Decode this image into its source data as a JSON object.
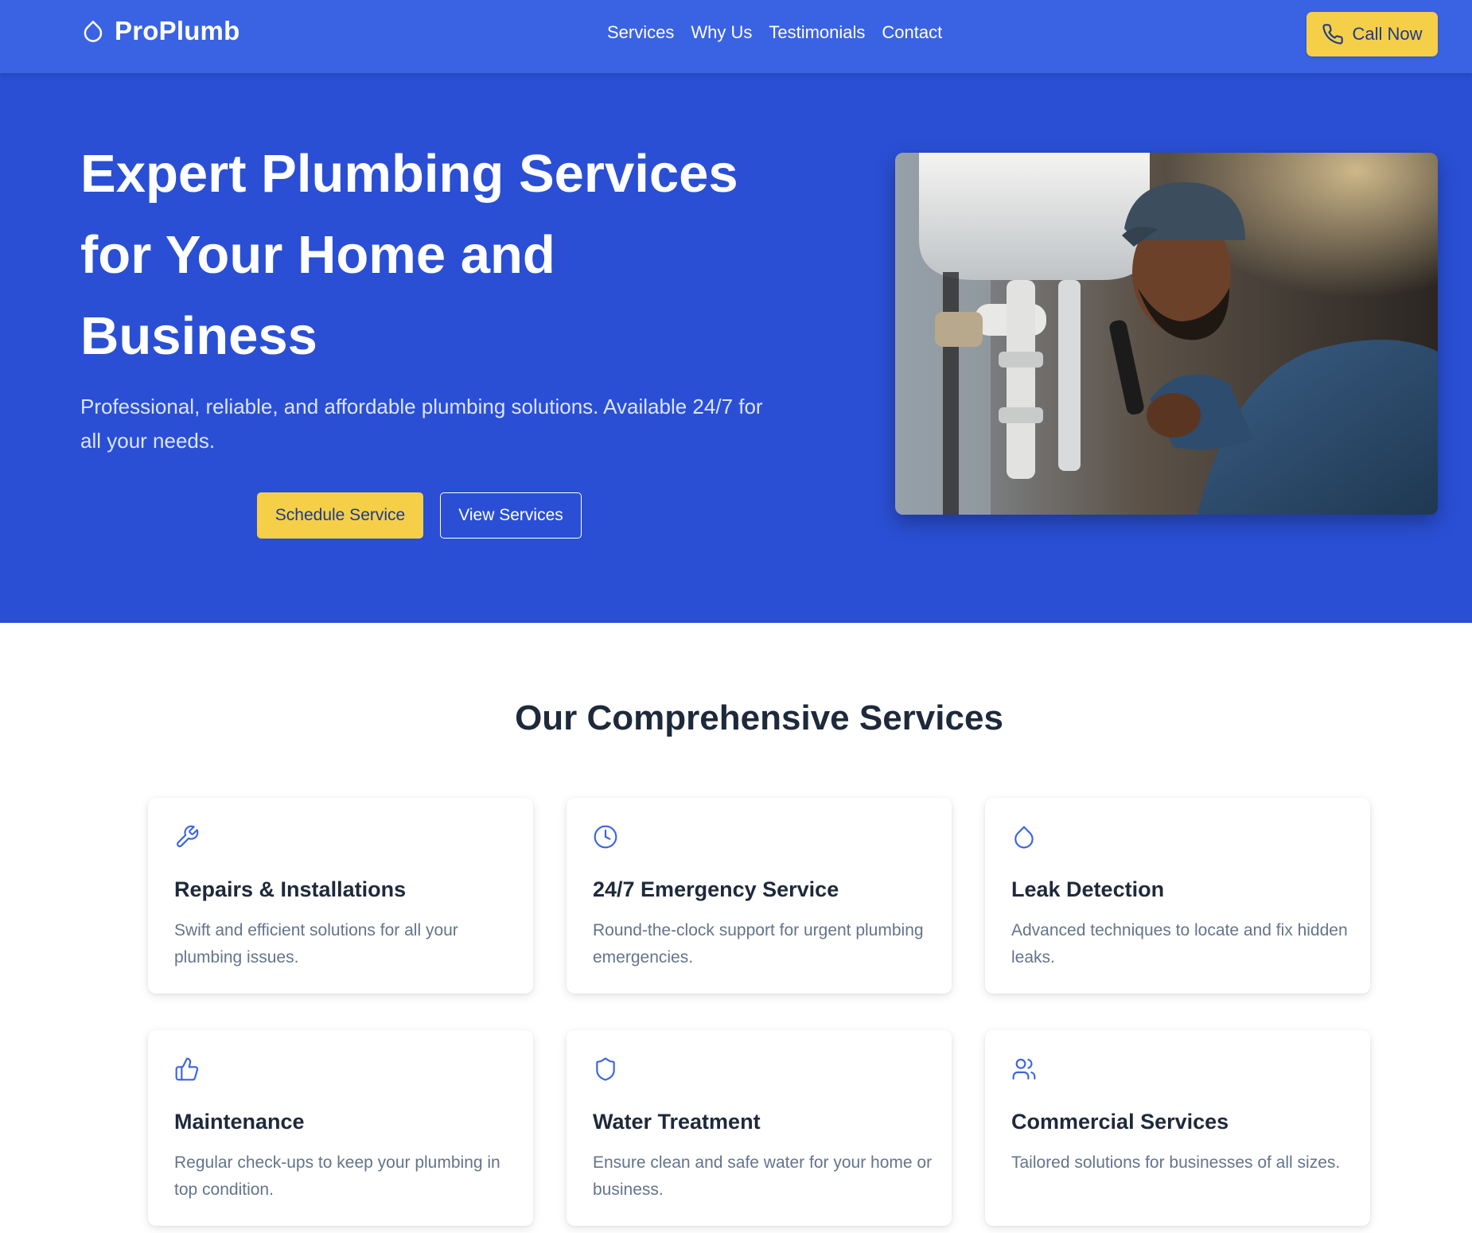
{
  "nav": {
    "brand": "ProPlumb",
    "links": [
      "Services",
      "Why Us",
      "Testimonials",
      "Contact"
    ],
    "cta": "Call Now"
  },
  "hero": {
    "title": "Expert Plumbing Services for Your Home and Business",
    "subtitle": "Professional, reliable, and affordable plumbing solutions. Available 24/7 for all your needs.",
    "primary_button": "Schedule Service",
    "secondary_button": "View Services"
  },
  "services": {
    "title": "Our Comprehensive Services",
    "items": [
      {
        "icon": "wrench-icon",
        "title": "Repairs & Installations",
        "description": "Swift and efficient solutions for all your plumbing issues."
      },
      {
        "icon": "clock-icon",
        "title": "24/7 Emergency Service",
        "description": "Round-the-clock support for urgent plumbing emergencies."
      },
      {
        "icon": "droplet-icon",
        "title": "Leak Detection",
        "description": "Advanced techniques to locate and fix hidden leaks."
      },
      {
        "icon": "thumbs-up-icon",
        "title": "Maintenance",
        "description": "Regular check-ups to keep your plumbing in top condition."
      },
      {
        "icon": "shield-icon",
        "title": "Water Treatment",
        "description": "Ensure clean and safe water for your home or business."
      },
      {
        "icon": "users-icon",
        "title": "Commercial Services",
        "description": "Tailored solutions for businesses of all sizes."
      }
    ]
  },
  "colors": {
    "nav": "#3a63e3",
    "hero": "#2a4fd4",
    "accent": "#f5cf48",
    "icon": "#3a63e3"
  }
}
